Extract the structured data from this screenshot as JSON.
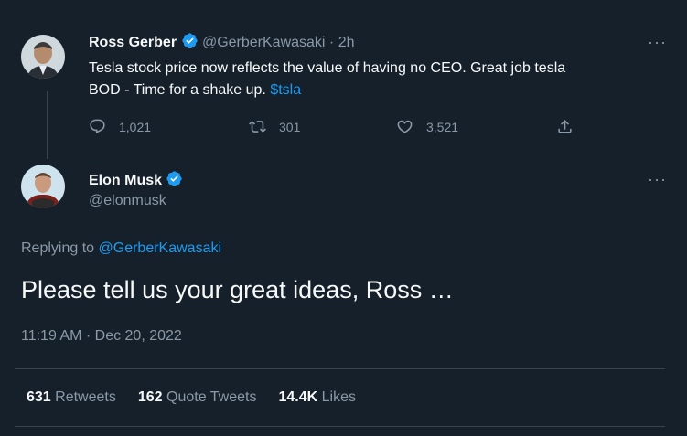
{
  "parent_tweet": {
    "name": "Ross Gerber",
    "handle": "@GerberKawasaki",
    "separator": "·",
    "time": "2h",
    "text_line1": "Tesla stock price now reflects the value of having no CEO. Great job tesla",
    "text_line2": "BOD - Time for a shake up.",
    "cashtag": "$tsla",
    "replies": "1,021",
    "retweets": "301",
    "likes": "3,521"
  },
  "main_tweet": {
    "name": "Elon Musk",
    "handle": "@elonmusk",
    "replying_label": "Replying to",
    "replying_to": "@GerberKawasaki",
    "text": "Please tell us your great ideas, Ross …",
    "timestamp": "11:19 AM · Dec 20, 2022"
  },
  "stats": {
    "retweets_count": "631",
    "retweets_label": "Retweets",
    "quote_count": "162",
    "quote_label": "Quote Tweets",
    "likes_count": "14.4K",
    "likes_label": "Likes"
  },
  "colors": {
    "background": "#15202b",
    "accent": "#1d9bf0",
    "muted": "#8b98a5",
    "verified": "#1d9bf0"
  }
}
